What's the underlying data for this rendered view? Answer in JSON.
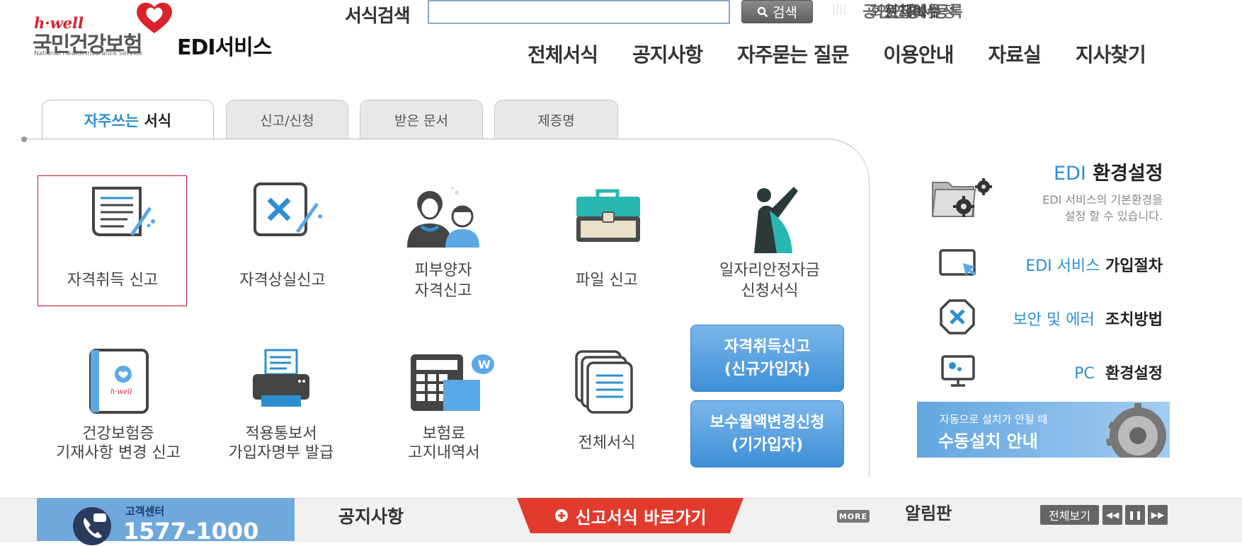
{
  "logo": {
    "brand": "h·well",
    "name": "국민건강보험",
    "english": "National Health Insurance Service"
  },
  "service_title_bold": "EDI",
  "service_title": "서비스",
  "search": {
    "label": "서식검색",
    "placeholder": "",
    "button": "검색"
  },
  "util_links": [
    {
      "label": "홈"
    },
    {
      "label": "로그아웃"
    },
    {
      "label": "회원정보수정"
    },
    {
      "label": "공인인증서등록"
    },
    {
      "label": "전체메뉴"
    }
  ],
  "gnav": [
    "전체서식",
    "공지사항",
    "자주묻는 질문",
    "이용안내",
    "자료실",
    "지사찾기"
  ],
  "tabs": [
    {
      "hl": "자주쓰는",
      "label": " 서식"
    },
    {
      "label": "신고/신청"
    },
    {
      "label": "받은 문서"
    },
    {
      "label": "제증명"
    }
  ],
  "forms": [
    {
      "label": "자격취득 신고",
      "icon": "document-pen-icon"
    },
    {
      "label": "자격상실신고",
      "icon": "document-x-icon"
    },
    {
      "label1": "피부양자",
      "label2": "자격신고",
      "icon": "people-icon"
    },
    {
      "label": "파일 신고",
      "icon": "briefcase-icon"
    },
    {
      "label1": "일자리안정자금",
      "label2": "신청서식",
      "icon": "superhero-icon"
    },
    {
      "label1": "건강보험증",
      "label2": "기재사항 변경 신고",
      "icon": "insurance-card-icon"
    },
    {
      "label1": "적용통보서",
      "label2": "가입자명부 발급",
      "icon": "printer-icon"
    },
    {
      "label1": "보험료",
      "label2": "고지내역서",
      "icon": "calculator-icon"
    },
    {
      "label": "전체서식",
      "icon": "documents-stack-icon"
    }
  ],
  "quick_buttons": [
    {
      "line1": "자격취득신고",
      "line2": "(신규가입자)"
    },
    {
      "line1": "보수월액변경신청",
      "line2": "(기가입자)"
    }
  ],
  "right": {
    "env_title_blue": "EDI",
    "env_title": "환경설정",
    "env_desc1": "EDI 서비스의 기본환경을",
    "env_desc2": "설정 할 수 있습니다.",
    "links": [
      {
        "blue": "EDI 서비스",
        "black": "가입절차",
        "icon": "monitor-click-icon"
      },
      {
        "blue": "보안 및 에러",
        "black": "조치방법",
        "icon": "shield-x-icon"
      },
      {
        "blue": "PC",
        "black": "환경설정",
        "icon": "pc-settings-icon"
      }
    ],
    "banner_small": "자동으로 설치가 안될 때",
    "banner_big": "수동설치 안내"
  },
  "bottom": {
    "cs_label": "고객센터",
    "cs_phone": "1577-1000",
    "notice": "공지사항",
    "shortcut": "신고서식 바로가기",
    "more": "MORE",
    "alarm": "알림판",
    "view_all": "전체보기"
  },
  "colors": {
    "accent_blue": "#2d8fd0",
    "selection_red": "#c8102e",
    "shortcut_red": "#e23a2c"
  }
}
